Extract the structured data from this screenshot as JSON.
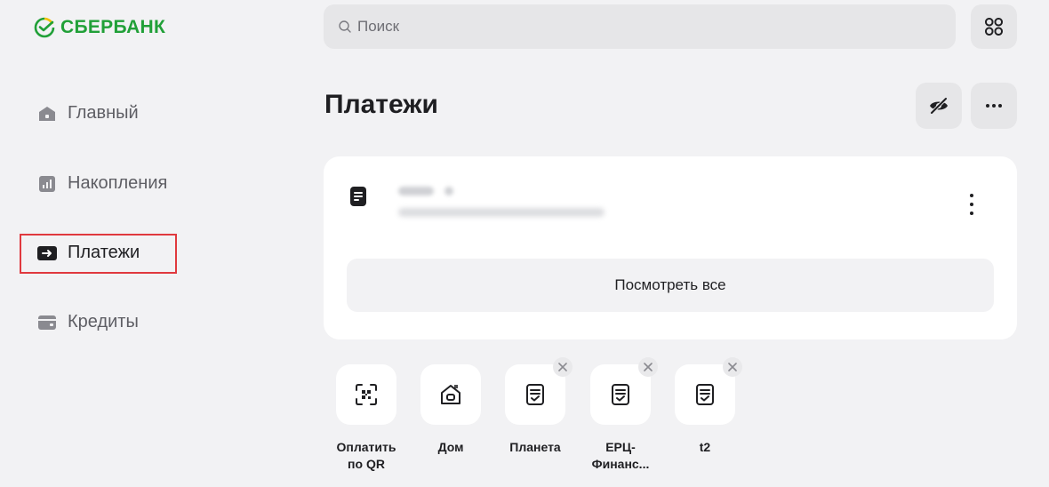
{
  "brand": {
    "name": "СБЕРБАНК",
    "color": "#21a038"
  },
  "search": {
    "placeholder": "Поиск"
  },
  "sidebar": {
    "items": [
      {
        "label": "Главный",
        "icon": "home-icon"
      },
      {
        "label": "Накопления",
        "icon": "chart-icon"
      },
      {
        "label": "Платежи",
        "icon": "payments-arrow-icon",
        "active": true
      },
      {
        "label": "Кредиты",
        "icon": "wallet-icon"
      }
    ]
  },
  "main": {
    "title": "Платежи",
    "card": {
      "see_all_label": "Посмотреть все"
    },
    "shortcuts": [
      {
        "label": "Оплатить по QR",
        "icon": "qr-scan-icon",
        "removable": false
      },
      {
        "label": "Дом",
        "icon": "house-icon",
        "removable": false
      },
      {
        "label": "Планета",
        "icon": "receipt-icon",
        "removable": true
      },
      {
        "label": "ЕРЦ-Финанс...",
        "icon": "receipt-icon",
        "removable": true
      },
      {
        "label": "t2",
        "icon": "receipt-icon",
        "removable": true
      }
    ]
  },
  "colors": {
    "highlight": "#e0393e",
    "background": "#f2f2f4",
    "tile": "#e6e6e8"
  }
}
